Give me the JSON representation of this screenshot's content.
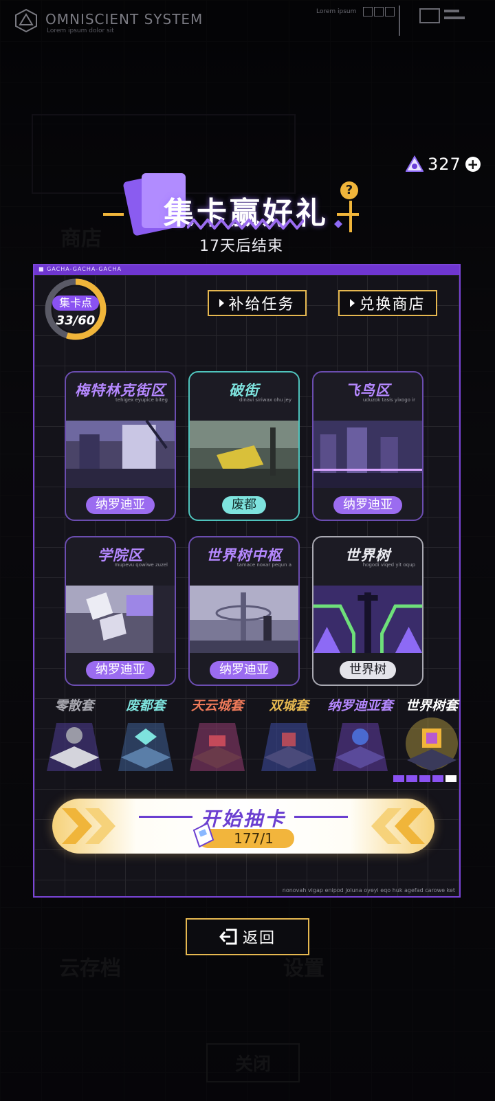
{
  "system": {
    "title": "OMNISCIENT SYSTEM",
    "subtitle": "Lorem ipsum dolor sit",
    "top_right_text": "Lorem ipsum"
  },
  "currency": {
    "icon": "triangle-token-icon",
    "value": "327",
    "plus": "+"
  },
  "header": {
    "title": "集卡赢好礼",
    "help": "?",
    "subtitle": "17天后结束"
  },
  "panel": {
    "strip_label": "■ GACHA-GACHA-GACHA",
    "footer_text": "nonovah vigap enipod joluna oyeyi eqo huk agefad carowe ket"
  },
  "points": {
    "label": "集卡点",
    "value": "33/60",
    "current": 33,
    "max": 60
  },
  "actions": {
    "supply_tasks": "补给任务",
    "exchange_shop": "兑换商店"
  },
  "areas": [
    {
      "title": "梅特林克街区",
      "sub": "tehigex eyupice biteg",
      "tag": "纳罗迪亚",
      "style": "purple"
    },
    {
      "title": "破街",
      "sub": "dinavi siriwax ohu jey",
      "tag": "废都",
      "style": "cyan"
    },
    {
      "title": "飞鸟区",
      "sub": "uduzok tasis yixogo ir",
      "tag": "纳罗迪亚",
      "style": "purple"
    },
    {
      "title": "学院区",
      "sub": "mupevu qowiwe zuzel",
      "tag": "纳罗迪亚",
      "style": "purple"
    },
    {
      "title": "世界树中枢",
      "sub": "tamace noxar pequn a",
      "tag": "纳罗迪亚",
      "style": "purple"
    },
    {
      "title": "世界树",
      "sub": "hogodi viqed yit oqup",
      "tag": "世界树",
      "style": "white"
    }
  ],
  "sets": [
    {
      "name": "零散套",
      "color": "#a8a8b0"
    },
    {
      "name": "废都套",
      "color": "#7ee3de"
    },
    {
      "name": "天云城套",
      "color": "#ef7a5a"
    },
    {
      "name": "双城套",
      "color": "#e6b850"
    },
    {
      "name": "纳罗迪亚套",
      "color": "#b588ff"
    },
    {
      "name": "世界树套",
      "color": "#ffffff"
    }
  ],
  "draw": {
    "label": "开始抽卡",
    "cost": "177/1"
  },
  "back": {
    "label": "返回"
  }
}
